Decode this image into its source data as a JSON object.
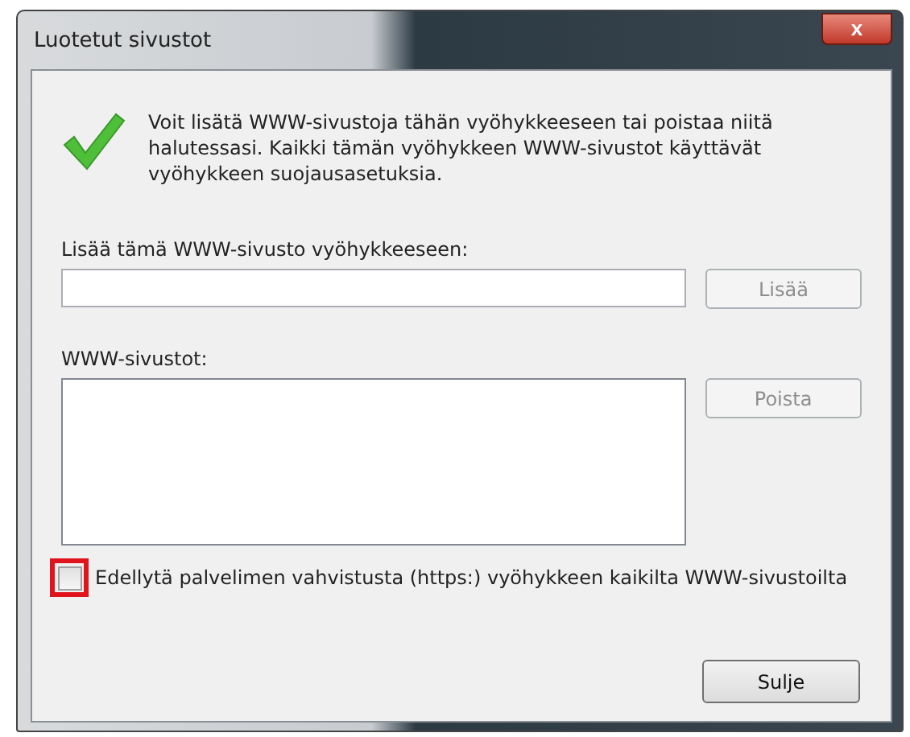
{
  "window": {
    "title": "Luotetut sivustot",
    "close_label": "x"
  },
  "message": "Voit lisätä WWW-sivustoja tähän vyöhykkeeseen tai poistaa niitä halutessasi. Kaikki tämän vyöhykkeen WWW-sivustot käyttävät vyöhykkeen suojausasetuksia.",
  "add_field": {
    "label": "Lisää tämä WWW-sivusto vyöhykkeeseen:"
  },
  "add_button": {
    "label": "Lisää",
    "disabled": true
  },
  "sites_list": {
    "label": "WWW-sivustot:"
  },
  "remove_button": {
    "label": "Poista",
    "disabled": true
  },
  "https_checkbox": {
    "label": "Edellytä palvelimen vahvistusta (https:) vyöhykkeen kaikilta WWW-sivustoilta",
    "checked": false,
    "highlighted": true
  },
  "close_button": {
    "label": "Sulje",
    "disabled": false
  }
}
